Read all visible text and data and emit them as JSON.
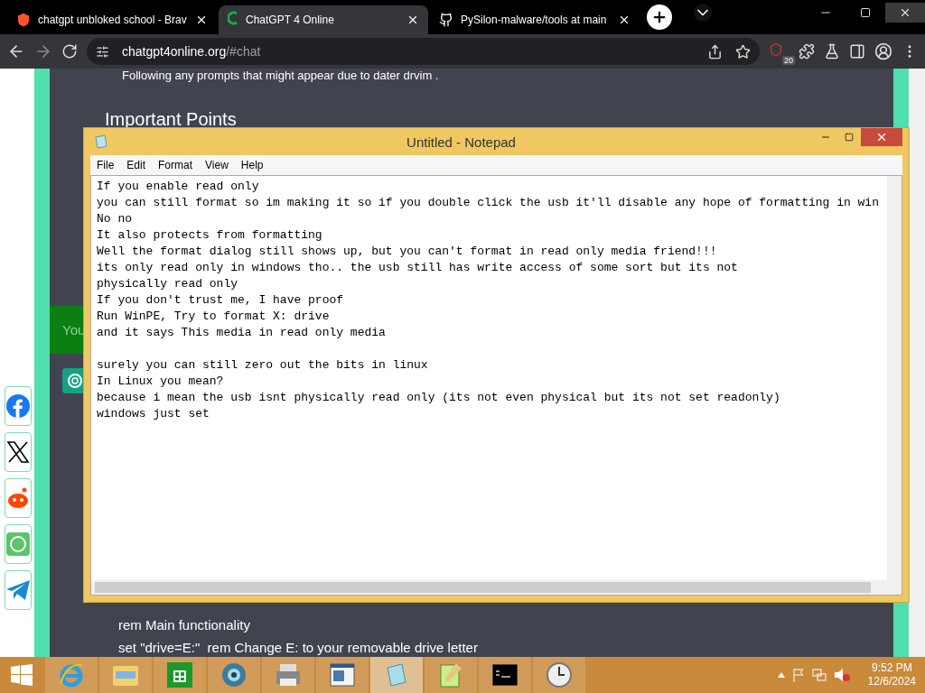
{
  "browser": {
    "tabs": [
      {
        "title": "chatgpt unbloked school - Brav",
        "selected": false
      },
      {
        "title": "ChatGPT 4 Online",
        "selected": true
      },
      {
        "title": "PySilon-malware/tools at main",
        "selected": false
      }
    ],
    "address": {
      "domain": "chatgpt4online.org",
      "path": "/#chat"
    },
    "extension_badge": "20"
  },
  "page": {
    "partial_line": "Following any prompts that might appear due to dater drvim .",
    "heading": "Important Points",
    "chat_label": "You",
    "code_lines": [
      "rem Main functionality",
      "set \"drive=E:\"  rem Change E: to your removable drive letter"
    ],
    "share": [
      {
        "kind": "facebook"
      },
      {
        "kind": "x"
      },
      {
        "kind": "reddit"
      },
      {
        "kind": "whatsapp"
      },
      {
        "kind": "telegram"
      }
    ]
  },
  "notepad": {
    "title": "Untitled - Notepad",
    "menu": [
      "File",
      "Edit",
      "Format",
      "View",
      "Help"
    ],
    "text": "If you enable read only\nyou can still format so im making it so if you double click the usb it'll disable any hope of formatting in win\nNo no\nIt also protects from formatting\nWell the format dialog still shows up, but you can't format in read only media friend!!!\nits only read only in windows tho.. the usb still has write access of some sort but its not\nphysically read only\nIf you don't trust me, I have proof\nRun WinPE, Try to format X: drive\nand it says This media in read only media\n\nsurely you can still zero out the bits in linux\nIn Linux you mean?\nbecause i mean the usb isnt physically read only (its not even physical but its not set readonly)\nwindows just set"
  },
  "taskbar": {
    "apps": [
      {
        "kind": "ie",
        "selected": false
      },
      {
        "kind": "folder",
        "selected": false
      },
      {
        "kind": "store",
        "selected": false
      },
      {
        "kind": "globe",
        "selected": false
      },
      {
        "kind": "printer",
        "selected": false
      },
      {
        "kind": "window",
        "selected": false
      },
      {
        "kind": "notepad",
        "selected": true
      },
      {
        "kind": "notepadpp",
        "selected": false
      },
      {
        "kind": "cmd",
        "selected": false
      },
      {
        "kind": "clock",
        "selected": false
      }
    ],
    "time": "9:52 PM",
    "date": "12/6/2024"
  }
}
